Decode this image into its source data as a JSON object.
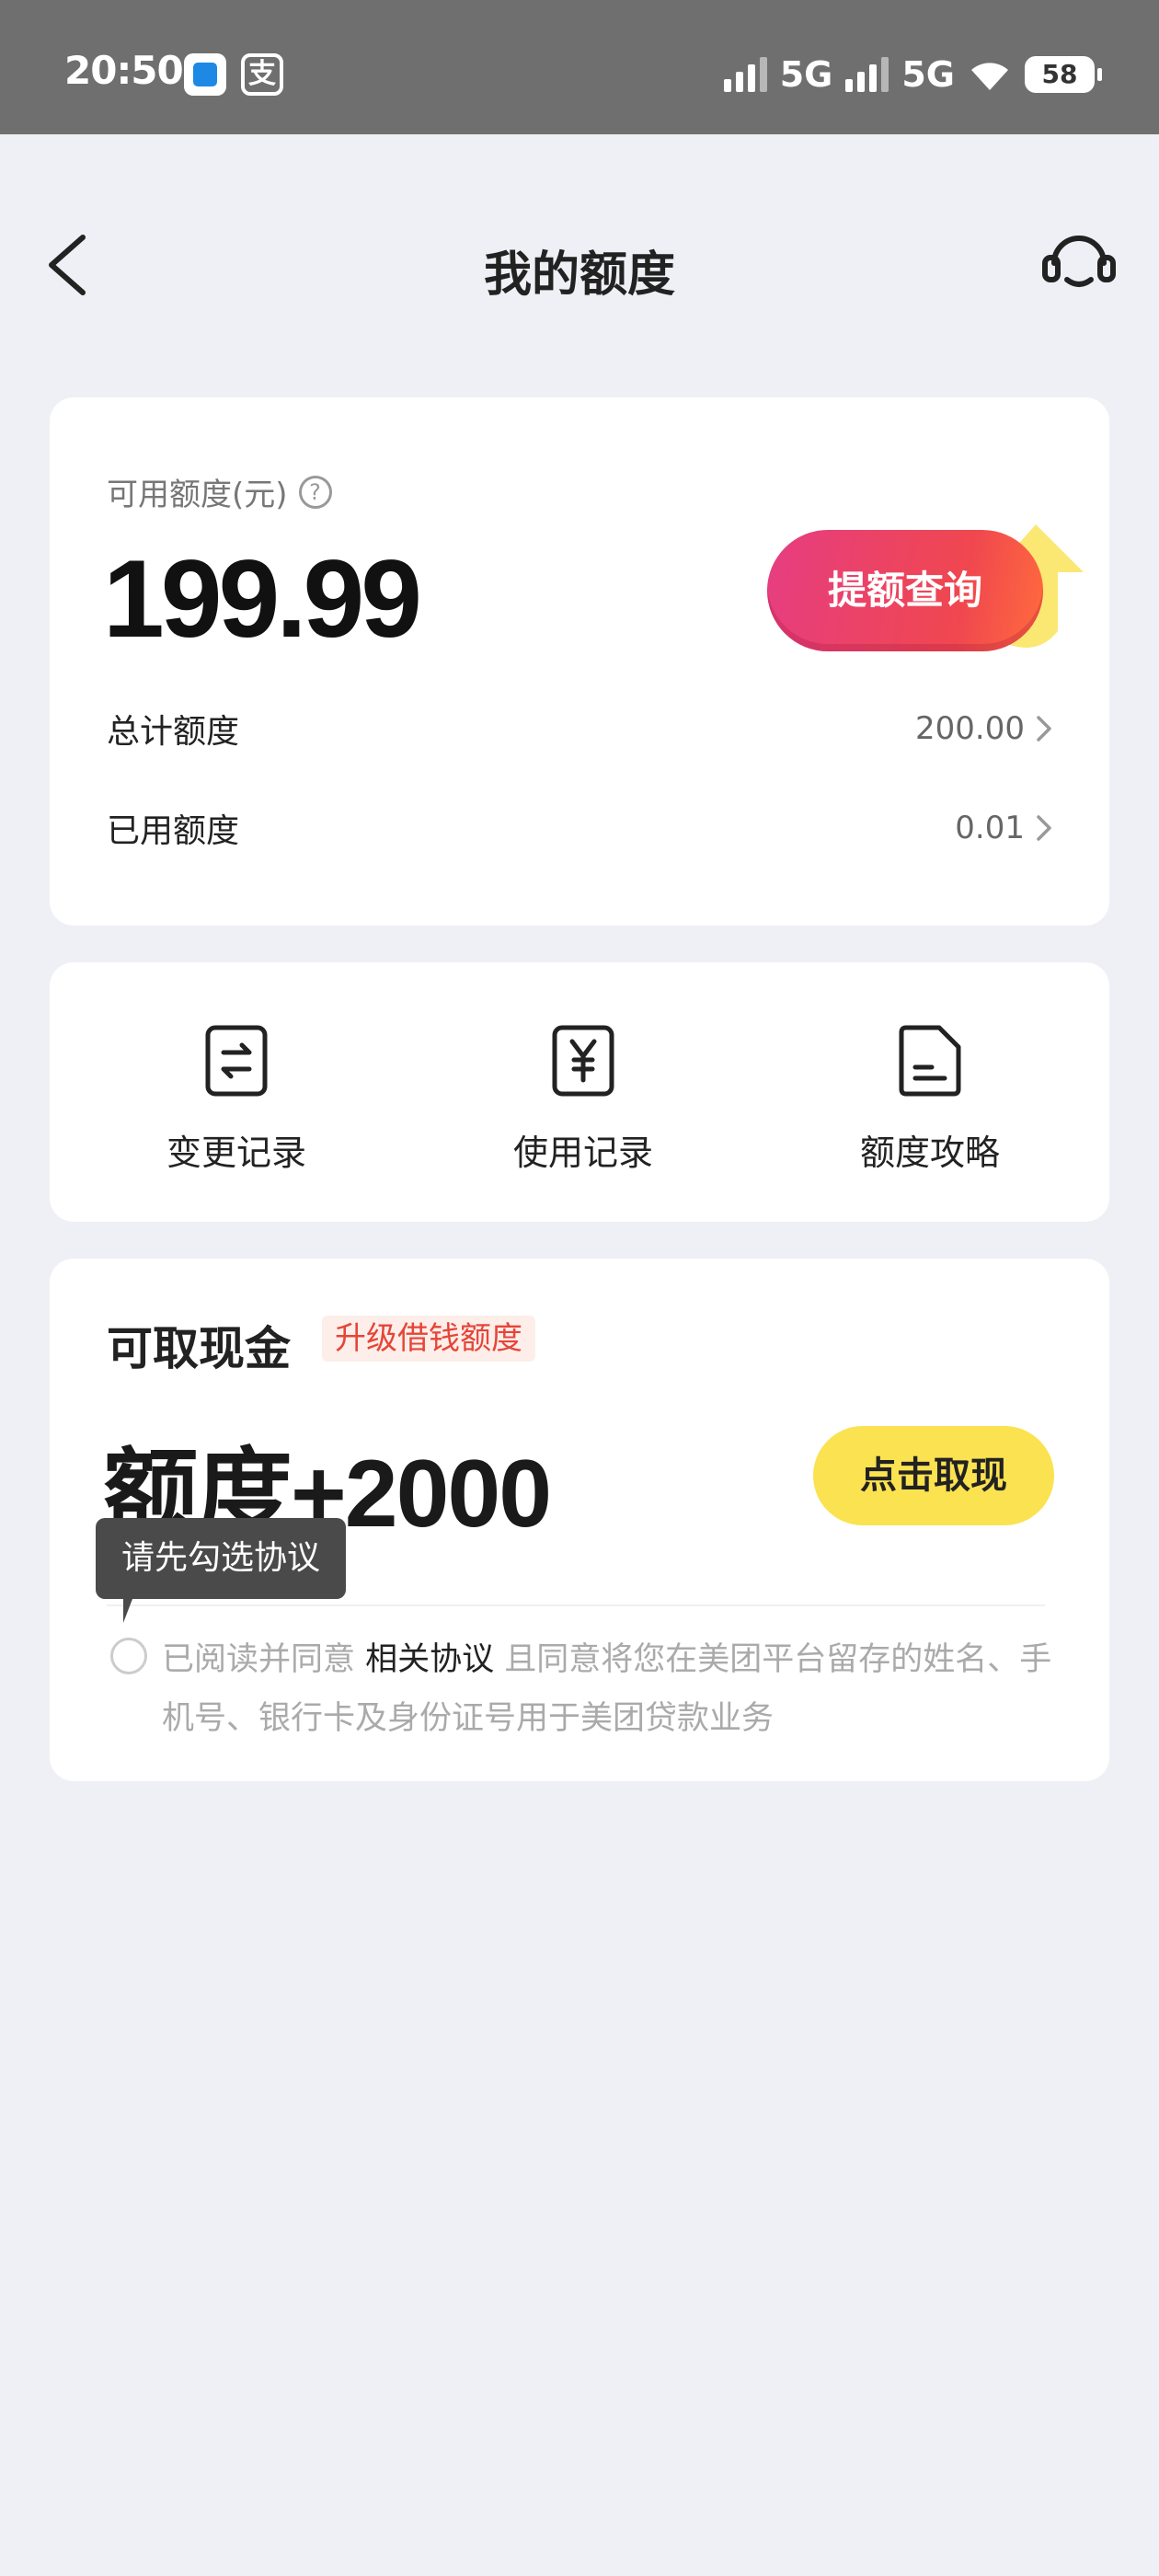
{
  "status_bar": {
    "time": "20:50",
    "app_icon_2_glyph": "支",
    "network_1": "5G",
    "network_2": "5G",
    "battery": "58"
  },
  "header": {
    "title": "我的额度",
    "back_icon": "chevron-left-icon",
    "service_icon": "headset-icon"
  },
  "credit": {
    "available_label": "可用额度(元)",
    "help_glyph": "?",
    "available_amount": "199.99",
    "raise_button_label": "提额查询",
    "rows": [
      {
        "label": "总计额度",
        "value": "200.00"
      },
      {
        "label": "已用额度",
        "value": "0.01"
      }
    ]
  },
  "shortcuts": [
    {
      "label": "变更记录",
      "icon": "exchange-record-icon"
    },
    {
      "label": "使用记录",
      "icon": "yuan-record-icon"
    },
    {
      "label": "额度攻略",
      "icon": "document-icon"
    }
  ],
  "cash": {
    "title": "可取现金",
    "badge": "升级借钱额度",
    "amount": "额度+2000",
    "withdraw_button_label": "点击取现",
    "tooltip": "请先勾选协议",
    "agreement": {
      "prefix": "已阅读并同意 ",
      "link": "相关协议",
      "suffix": " 且同意将您在美团平台留存的姓名、手机号、银行卡及身份证号用于美团贷款业务"
    }
  },
  "colors": {
    "background": "#eff0f5",
    "status_bar": "#6f6f6f",
    "raise_button": "#e93f6a",
    "withdraw_button": "#fbe250",
    "badge_text": "#e64538",
    "badge_bg": "#fdeeea"
  }
}
